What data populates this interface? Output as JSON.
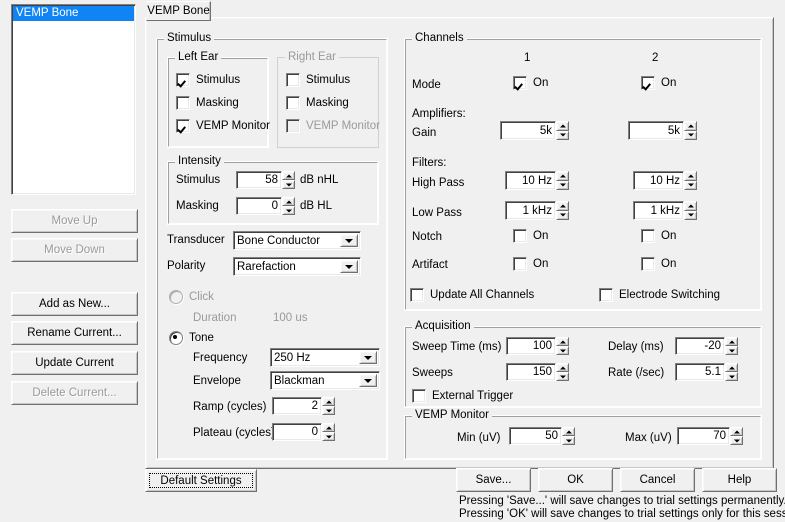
{
  "list": {
    "items": [
      {
        "label": "VEMP Bone",
        "selected": true
      }
    ]
  },
  "list_buttons": [
    {
      "label": "Move Up",
      "enabled": false,
      "accel": "U"
    },
    {
      "label": "Move Down",
      "enabled": false,
      "accel": "w"
    },
    {
      "label": "Add as New...",
      "enabled": true,
      "accel": "A"
    },
    {
      "label": "Rename Current...",
      "enabled": true,
      "accel": "R"
    },
    {
      "label": "Update Current",
      "enabled": true,
      "accel": "U"
    },
    {
      "label": "Delete Current...",
      "enabled": false,
      "accel": "D"
    }
  ],
  "tab": {
    "label": "VEMP Bone"
  },
  "stimulus": {
    "title": "Stimulus",
    "left_ear": {
      "title": "Left Ear",
      "items": [
        {
          "label": "Stimulus",
          "checked": true,
          "enabled": true
        },
        {
          "label": "Masking",
          "checked": false,
          "enabled": true
        },
        {
          "label": "VEMP Monitor",
          "checked": true,
          "enabled": true
        }
      ]
    },
    "right_ear": {
      "title": "Right Ear",
      "items": [
        {
          "label": "Stimulus",
          "checked": false,
          "enabled": true
        },
        {
          "label": "Masking",
          "checked": false,
          "enabled": true
        },
        {
          "label": "VEMP Monitor",
          "checked": false,
          "enabled": false
        }
      ]
    },
    "intensity": {
      "title": "Intensity",
      "stimulus_label": "Stimulus",
      "stimulus_value": "58",
      "stimulus_unit": "dB nHL",
      "masking_label": "Masking",
      "masking_value": "0",
      "masking_unit": "dB HL"
    },
    "transducer_label": "Transducer",
    "transducer_value": "Bone Conductor",
    "polarity_label": "Polarity",
    "polarity_value": "Rarefaction",
    "click": {
      "label": "Click",
      "selected": false,
      "duration_label": "Duration",
      "duration_value": "100 us"
    },
    "tone": {
      "label": "Tone",
      "selected": true,
      "frequency_label": "Frequency",
      "frequency_value": "250 Hz",
      "envelope_label": "Envelope",
      "envelope_value": "Blackman",
      "ramp_label": "Ramp (cycles)",
      "ramp_value": "2",
      "plateau_label": "Plateau (cycles)",
      "plateau_value": "0"
    }
  },
  "channels": {
    "title": "Channels",
    "col1_header": "1",
    "col2_header": "2",
    "mode_label": "Mode",
    "mode_ch1": {
      "label": "On",
      "checked": true
    },
    "mode_ch2": {
      "label": "On",
      "checked": true
    },
    "amplifiers_label": "Amplifiers:",
    "gain_label": "Gain",
    "gain_ch1": "5k",
    "gain_ch2": "5k",
    "filters_label": "Filters:",
    "high_pass_label": "High Pass",
    "high_pass_ch1": "10 Hz",
    "high_pass_ch2": "10 Hz",
    "low_pass_label": "Low Pass",
    "low_pass_ch1": "1 kHz",
    "low_pass_ch2": "1 kHz",
    "notch_label": "Notch",
    "notch_ch1": {
      "label": "On",
      "checked": false
    },
    "notch_ch2": {
      "label": "On",
      "checked": false
    },
    "artifact_label": "Artifact",
    "artifact_ch1": {
      "label": "On",
      "checked": false
    },
    "artifact_ch2": {
      "label": "On",
      "checked": false
    },
    "update_all": {
      "label": "Update All Channels",
      "checked": false
    },
    "electrode_switching": {
      "label": "Electrode Switching",
      "checked": false
    }
  },
  "acquisition": {
    "title": "Acquisition",
    "sweep_time_label": "Sweep Time (ms)",
    "sweep_time_value": "100",
    "delay_label": "Delay (ms)",
    "delay_value": "-20",
    "sweeps_label": "Sweeps",
    "sweeps_value": "150",
    "rate_label": "Rate (/sec)",
    "rate_value": "5.1",
    "external_trigger": {
      "label": "External Trigger",
      "checked": false
    }
  },
  "vemp_monitor": {
    "title": "VEMP Monitor",
    "min_label": "Min (uV)",
    "min_value": "50",
    "max_label": "Max (uV)",
    "max_value": "70"
  },
  "footer": {
    "default_settings": "Default Settings",
    "save": "Save...",
    "ok": "OK",
    "cancel": "Cancel",
    "help": "Help",
    "note_line1": "Pressing 'Save...' will save changes to trial settings permanently.",
    "note_line2": "Pressing 'OK' will save changes to trial settings only for this session."
  },
  "colors": {
    "face": "#f0f0f0",
    "selection": "#1084f5",
    "disabled_text": "#9a9a9a"
  }
}
